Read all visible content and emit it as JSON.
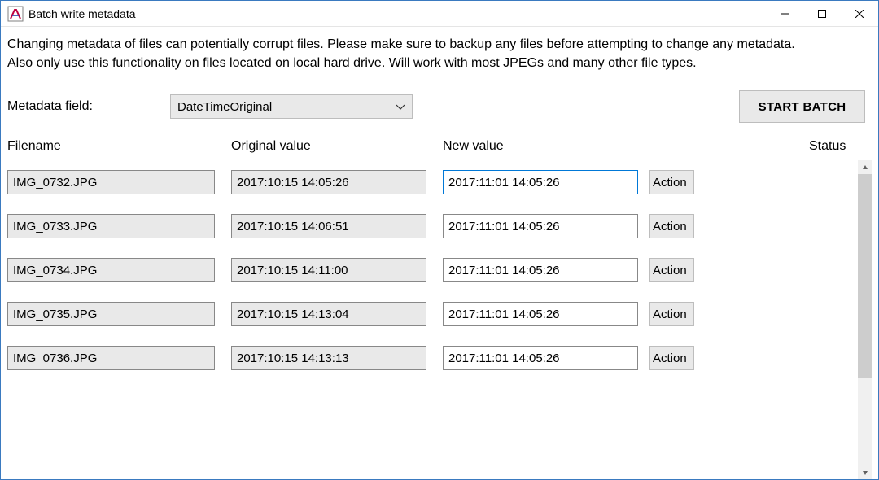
{
  "window": {
    "title": "Batch write metadata"
  },
  "warning": {
    "line1": "Changing metadata of files can potentially corrupt files. Please make sure to backup any files before attempting to change any metadata.",
    "line2": "Also only use this functionality on files located on local hard drive. Will work with most JPEGs and many other file types."
  },
  "controls": {
    "field_label": "Metadata field:",
    "field_selected": "DateTimeOriginal",
    "start_label": "START BATCH"
  },
  "columns": {
    "filename": "Filename",
    "original": "Original value",
    "newval": "New value",
    "status": "Status"
  },
  "action_label": "Action",
  "rows": [
    {
      "filename": "IMG_0732.JPG",
      "original": "2017:10:15 14:05:26",
      "newval": "2017:11:01 14:05:26",
      "active": true
    },
    {
      "filename": "IMG_0733.JPG",
      "original": "2017:10:15 14:06:51",
      "newval": "2017:11:01 14:05:26",
      "active": false
    },
    {
      "filename": "IMG_0734.JPG",
      "original": "2017:10:15 14:11:00",
      "newval": "2017:11:01 14:05:26",
      "active": false
    },
    {
      "filename": "IMG_0735.JPG",
      "original": "2017:10:15 14:13:04",
      "newval": "2017:11:01 14:05:26",
      "active": false
    },
    {
      "filename": "IMG_0736.JPG",
      "original": "2017:10:15 14:13:13",
      "newval": "2017:11:01 14:05:26",
      "active": false
    }
  ]
}
